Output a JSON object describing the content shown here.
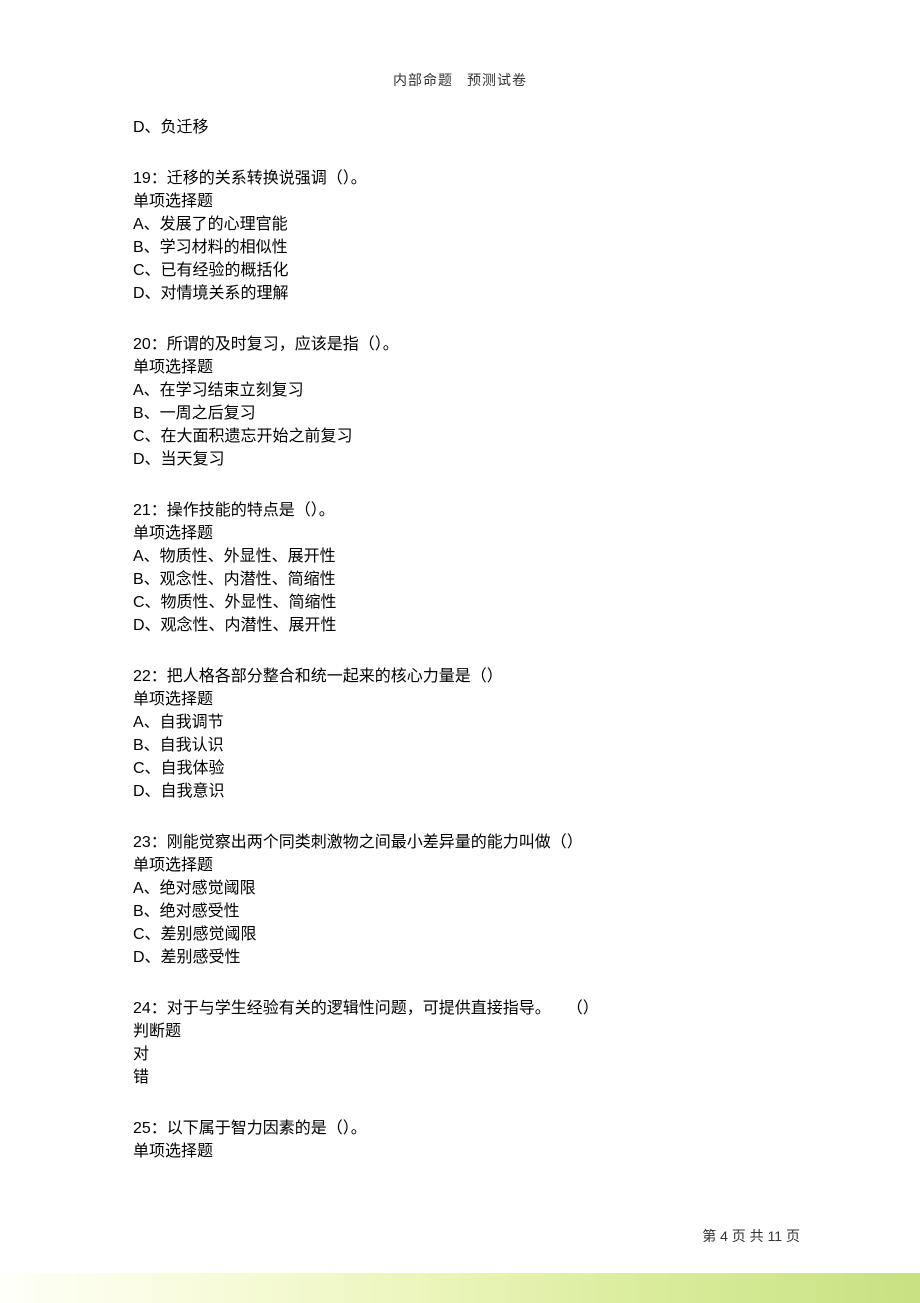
{
  "header": {
    "left": "内部命题",
    "right": "预测试卷"
  },
  "orphan_option": "D、负迁移",
  "questions": [
    {
      "stem": "19：迁移的关系转换说强调（）。",
      "type": "单项选择题",
      "options": [
        "A、发展了的心理官能",
        "B、学习材料的相似性",
        "C、已有经验的概括化",
        "D、对情境关系的理解"
      ]
    },
    {
      "stem": "20：所谓的及时复习，应该是指（）。",
      "type": "单项选择题",
      "options": [
        "A、在学习结束立刻复习",
        "B、一周之后复习",
        "C、在大面积遗忘开始之前复习",
        "D、当天复习"
      ]
    },
    {
      "stem": "21：操作技能的特点是（）。",
      "type": "单项选择题",
      "options": [
        "A、物质性、外显性、展开性",
        "B、观念性、内潜性、简缩性",
        "C、物质性、外显性、简缩性",
        "D、观念性、内潜性、展开性"
      ]
    },
    {
      "stem": "22：把人格各部分整合和统一起来的核心力量是（）",
      "type": "单项选择题",
      "options": [
        "A、自我调节",
        "B、自我认识",
        "C、自我体验",
        "D、自我意识"
      ]
    },
    {
      "stem": "23：刚能觉察出两个同类刺激物之间最小差异量的能力叫做（）",
      "type": "单项选择题",
      "options": [
        "A、绝对感觉阈限",
        "B、绝对感受性",
        "C、差别感觉阈限",
        "D、差别感受性"
      ]
    },
    {
      "stem": "24：对于与学生经验有关的逻辑性问题，可提供直接指导。　　（）",
      "type": "判断题",
      "options": [
        "对",
        "错"
      ]
    },
    {
      "stem": "25：以下属于智力因素的是（）。",
      "type": "单项选择题",
      "options": []
    }
  ],
  "footer": {
    "text": "第 4 页 共 11 页"
  }
}
